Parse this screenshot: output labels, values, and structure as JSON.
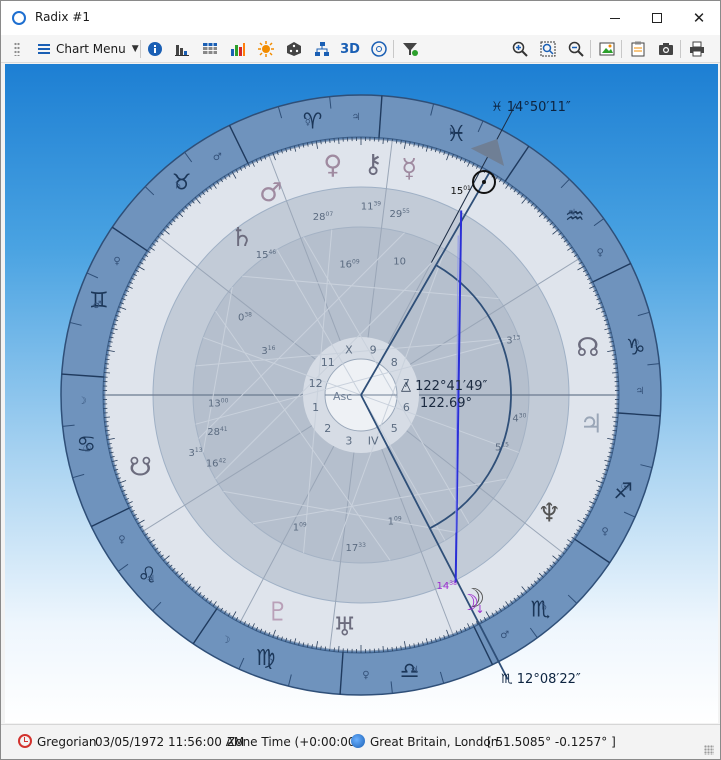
{
  "window": {
    "title": "Radix #1"
  },
  "toolbar": {
    "chart_menu_label": "Chart Menu",
    "icons": [
      "info-icon",
      "bar-chart-icon",
      "grid-table-icon",
      "column-chart-icon",
      "sun-icon",
      "dice-icon",
      "tree-icon",
      "3d-icon",
      "cd-icon",
      "filter-icon",
      "zoom-in-icon",
      "zoom-fit-icon",
      "zoom-out-icon",
      "image-export-icon",
      "clipboard-icon",
      "camera-icon",
      "print-icon"
    ],
    "three_d_label": "3D",
    "accent": "#1a5fb4"
  },
  "chart": {
    "top_label": "♓ 14°50′11″",
    "bottom_label": "♏ 12°08′22″",
    "aspect_angle_label": "△ 122°41′49″",
    "aspect_decimal_label": "122.69°",
    "asc_label": "Asc",
    "sun_degree": "15",
    "sun_minute": "01",
    "moon_degree": "14",
    "moon_minute": "38",
    "house_numbers": [
      "1",
      "2",
      "3",
      "IV",
      "5",
      "6",
      "7",
      "8",
      "9",
      "X",
      "11",
      "12"
    ],
    "cusp_degrees": [
      {
        "d": "11",
        "m": "39"
      },
      {
        "d": "29",
        "m": "55"
      },
      {
        "d": "28",
        "m": "07"
      },
      {
        "d": "15",
        "m": "46"
      },
      {
        "d": "16",
        "m": "09"
      },
      {
        "d": "0",
        "m": "38"
      },
      {
        "d": "3",
        "m": "16"
      },
      {
        "d": "10",
        "m": ""
      },
      {
        "d": "3",
        "m": "13"
      },
      {
        "d": "4",
        "m": "30"
      },
      {
        "d": "5",
        "m": "15"
      },
      {
        "d": "13",
        "m": "00"
      },
      {
        "d": "28",
        "m": "41"
      },
      {
        "d": "3",
        "m": "13"
      },
      {
        "d": "16",
        "m": "42"
      },
      {
        "d": "1",
        "m": "09"
      },
      {
        "d": "17",
        "m": "33"
      },
      {
        "d": "1",
        "m": "09"
      }
    ],
    "colors": {
      "zodiac_ring": "#5f86b3",
      "house_ring": "#d9e0ea",
      "inner_disc": "#b9c3d0",
      "aspect_line": "#2a2fd6",
      "moon": "#9d2ccf"
    }
  },
  "status": {
    "calendar": "Gregorian",
    "datetime": "03/05/1972 11:56:00 AM",
    "zone": "Zone Time (+0:00:00)",
    "location": "Great Britain, London",
    "coords": "[ 51.5085°  -0.1257° ]"
  }
}
